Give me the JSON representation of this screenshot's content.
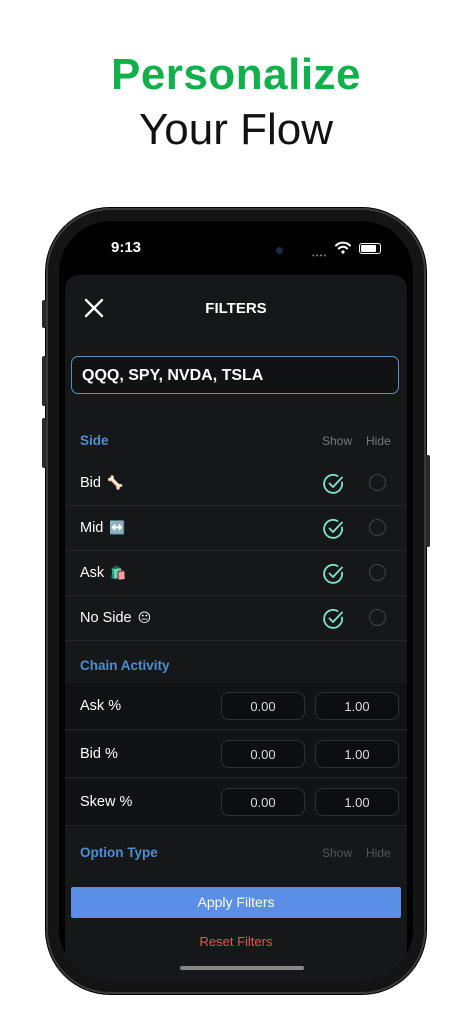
{
  "headline": {
    "line1": "Personalize",
    "line2": "Your Flow"
  },
  "status": {
    "time": "9:13"
  },
  "filters": {
    "title": "FILTERS",
    "tickers_value": "QQQ, SPY, NVDA, TSLA",
    "side": {
      "label": "Side",
      "show_header": "Show",
      "hide_header": "Hide",
      "rows": [
        {
          "label": "Bid",
          "emoji": "🦴",
          "selected": "show"
        },
        {
          "label": "Mid",
          "emoji": "↔️",
          "selected": "show"
        },
        {
          "label": "Ask",
          "emoji": "🛍️",
          "selected": "show"
        },
        {
          "label": "No Side",
          "emoji": "😐",
          "selected": "show"
        }
      ]
    },
    "chain_activity": {
      "label": "Chain Activity",
      "rows": [
        {
          "label": "Ask %",
          "min": "0.00",
          "max": "1.00"
        },
        {
          "label": "Bid %",
          "min": "0.00",
          "max": "1.00"
        },
        {
          "label": "Skew %",
          "min": "0.00",
          "max": "1.00"
        }
      ]
    },
    "option_type": {
      "label": "Option Type",
      "show_header": "Show",
      "hide_header": "Hide"
    },
    "apply_label": "Apply Filters",
    "reset_label": "Reset Filters"
  },
  "colors": {
    "brand_green": "#10b04a",
    "accent_blue": "#4c8fd0",
    "apply_blue": "#5b8ee6",
    "reset_red": "#e0554f",
    "check_teal": "#7fe3d2"
  }
}
